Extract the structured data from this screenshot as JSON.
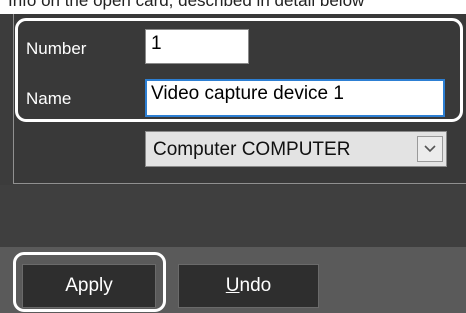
{
  "top_strip_text": "Info on the open card, described in detail below",
  "form": {
    "number_label": "Number",
    "number_value": "1",
    "name_label": "Name",
    "name_value": "Video capture device 1",
    "computer_value": "Computer COMPUTER"
  },
  "buttons": {
    "apply_label": "Apply",
    "undo_mnemonic": "U",
    "undo_rest": "ndo"
  },
  "colors": {
    "background": "#3c3c3c",
    "footer": "#5a5a5a",
    "callout_outline": "#ffffff",
    "focus_border": "#2d7fd3"
  },
  "icons": {
    "dropdown": "chevron-down-icon"
  }
}
